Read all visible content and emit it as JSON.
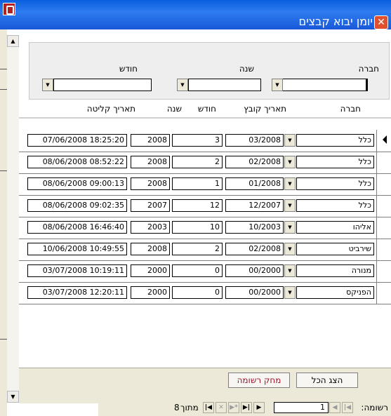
{
  "window": {
    "title": "יומן יבוא קבצים"
  },
  "filters": {
    "company_label": "חברה",
    "year_label": "שנה",
    "month_label": "חודש",
    "company_value": "",
    "year_value": "",
    "month_value": ""
  },
  "columns": {
    "company": "חברה",
    "file_date": "תאריך קובץ",
    "month": "חודש",
    "year": "שנה",
    "receipt_date": "תאריך קליטה"
  },
  "rows": [
    {
      "company": "כלל",
      "file_date": "03/2008",
      "month": "3",
      "year": "2008",
      "receipt_date": "07/06/2008 18:25:20"
    },
    {
      "company": "כלל",
      "file_date": "02/2008",
      "month": "2",
      "year": "2008",
      "receipt_date": "08/06/2008 08:52:22"
    },
    {
      "company": "כלל",
      "file_date": "01/2008",
      "month": "1",
      "year": "2008",
      "receipt_date": "08/06/2008 09:00:13"
    },
    {
      "company": "כלל",
      "file_date": "12/2007",
      "month": "12",
      "year": "2007",
      "receipt_date": "08/06/2008 09:02:35"
    },
    {
      "company": "אליהו",
      "file_date": "10/2003",
      "month": "10",
      "year": "2003",
      "receipt_date": "08/06/2008 16:46:40"
    },
    {
      "company": "שירביט",
      "file_date": "02/2008",
      "month": "2",
      "year": "2008",
      "receipt_date": "10/06/2008 10:49:55"
    },
    {
      "company": "מנורה",
      "file_date": "00/2000",
      "month": "0",
      "year": "2000",
      "receipt_date": "03/07/2008 10:19:11"
    },
    {
      "company": "הפניקס",
      "file_date": "00/2000",
      "month": "0",
      "year": "2000",
      "receipt_date": "03/07/2008 12:20:11"
    }
  ],
  "buttons": {
    "show_all": "הצג הכל",
    "delete_record": "מחק רשומה"
  },
  "navigation": {
    "record_label": "רשומה:",
    "current_record": "1",
    "of_label": "מתוך",
    "total_records": "8"
  }
}
